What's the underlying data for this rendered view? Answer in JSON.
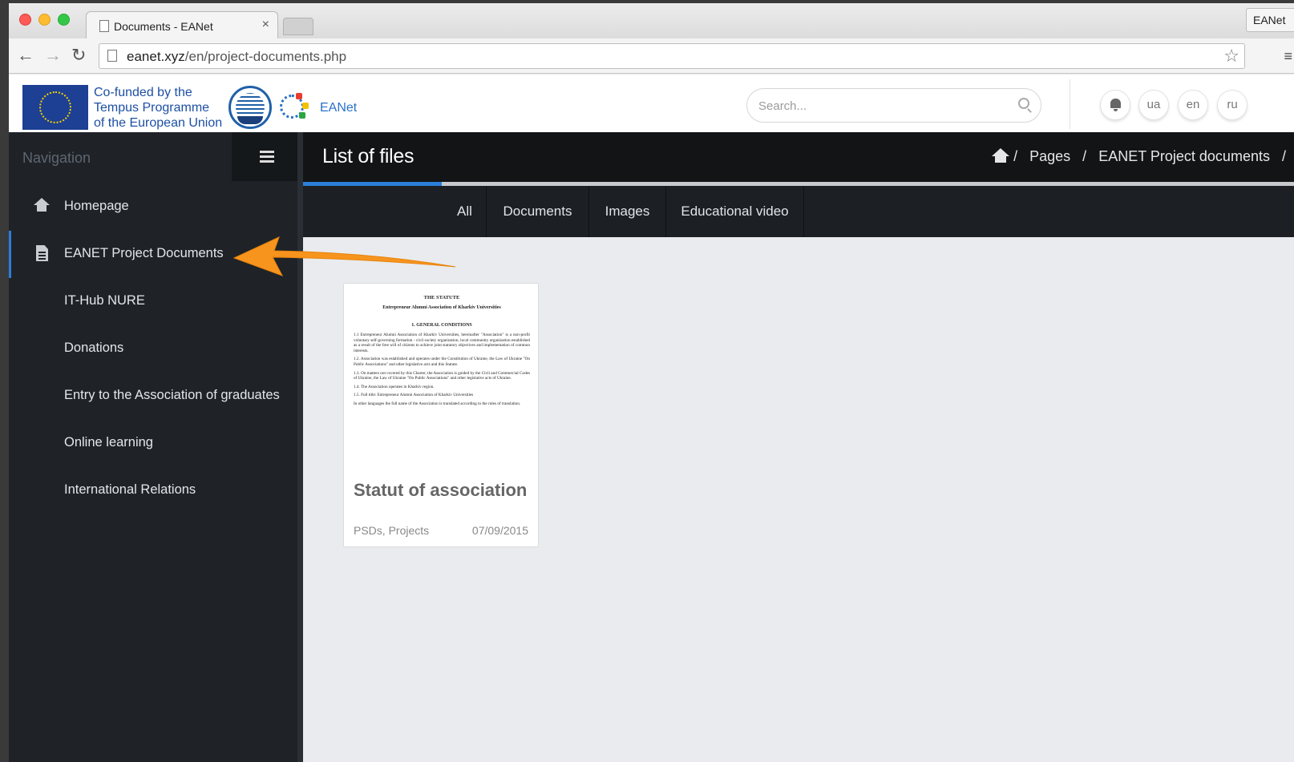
{
  "browser": {
    "tab_title": "Documents - EANet",
    "tab_close": "×",
    "profile_label": "EANet",
    "url_host": "eanet.xyz",
    "url_path": "/en/project-documents.php",
    "back_glyph": "←",
    "forward_glyph": "→",
    "reload_glyph": "↻",
    "star_glyph": "☆",
    "menu_glyph": "≡"
  },
  "header": {
    "cofund_lines": [
      "Co-funded by the",
      "Tempus Programme",
      "of the European Union"
    ],
    "brand": "EANet",
    "search_placeholder": "Search...",
    "lang_buttons": [
      "ua",
      "en",
      "ru"
    ]
  },
  "sidebar": {
    "title": "Navigation",
    "items": [
      {
        "label": "Homepage",
        "icon": "home-icon"
      },
      {
        "label": "EANET Project Documents",
        "icon": "document-icon",
        "active": true
      },
      {
        "label": "IT-Hub NURE"
      },
      {
        "label": "Donations"
      },
      {
        "label": "Entry to the Association of graduates"
      },
      {
        "label": "Online learning"
      },
      {
        "label": "International Relations"
      }
    ]
  },
  "main": {
    "title": "List of files",
    "breadcrumb": [
      "/",
      "Pages",
      "/",
      "EANET Project documents",
      "/"
    ],
    "progress": 0.14,
    "filter_tabs": [
      "All",
      "Documents",
      "Images",
      "Educational video"
    ]
  },
  "files": [
    {
      "title": "Statut of association",
      "tags": "PSDs, Projects",
      "date": "07/09/2015",
      "preview": {
        "heading": "THE STATUTE",
        "subheading": "Entrepreneur Alumni Association of Kharkiv Universities",
        "section": "1. GENERAL CONDITIONS",
        "paragraphs": [
          "1.1 Entrepreneur Alumni Association of Kharkiv Universities, hereinafter \"Association\" is a non-profit voluntary self-governing formation - civil society organization, local community organization established as a result of the free will of citizens to achieve joint statutory objectives and implementation of common interests.",
          "1.2. Association was established and operates under the Constitution of Ukraine, the Law of Ukraine \"On Public Associations\" and other legislative acts and this Statute.",
          "1.3. On matters not covered by this Charter, the Association is guided by the Civil and Commercial Codes of Ukraine, the Law of Ukraine \"On Public Associations\" and other legislative acts of Ukraine.",
          "1.4. The Association operates in Kharkiv region.",
          "1.5. Full title: Entrepreneur Alumni Association of Kharkiv Universities",
          "In other languages the full name of the Association is translated according to the rules of translation."
        ]
      }
    }
  ],
  "colors": {
    "accent": "#2b7fd9",
    "sidebar_bg": "#1f2328",
    "titlebar_bg": "#121416",
    "arrow": "#f7941d"
  }
}
